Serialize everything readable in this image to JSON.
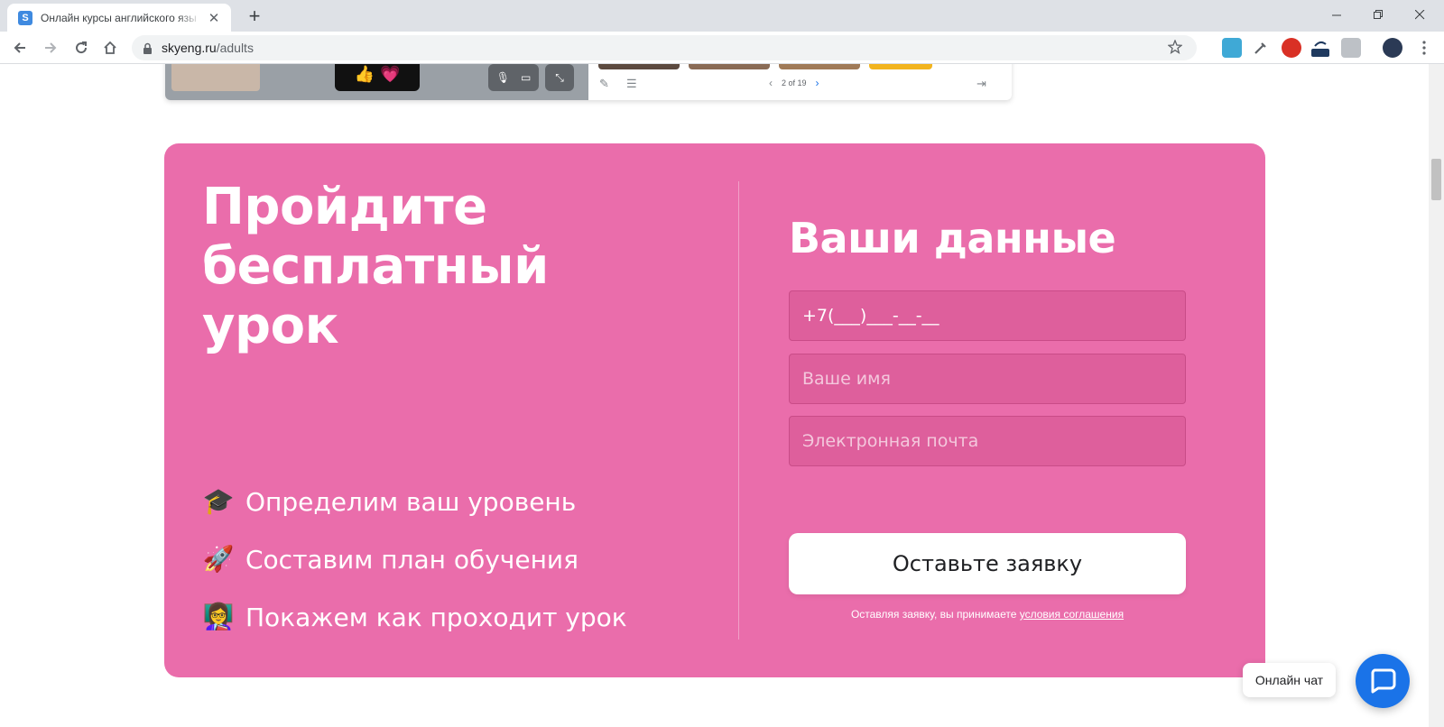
{
  "browser": {
    "tab_title": "Онлайн курсы английского язы",
    "favicon_letter": "S",
    "url_host": "skyeng.ru",
    "url_path": "/adults"
  },
  "preview": {
    "pager": "2 of 19"
  },
  "promo": {
    "headline": "Пройдите бесплатный урок",
    "features": [
      {
        "icon": "graduation-cap-icon",
        "glyph": "🎓",
        "text": "Определим ваш уровень"
      },
      {
        "icon": "rocket-icon",
        "glyph": "🚀",
        "text": "Составим план обучения"
      },
      {
        "icon": "teacher-icon",
        "glyph": "👩‍🏫",
        "text": "Покажем как проходит урок"
      }
    ]
  },
  "form": {
    "title": "Ваши данные",
    "phone_value": "+7(___)___-__-__",
    "name_placeholder": "Ваше имя",
    "email_placeholder": "Электронная почта",
    "submit_label": "Оставьте заявку",
    "legal_text": "Оставляя заявку, вы принимаете ",
    "legal_link": "условия соглашения"
  },
  "chat": {
    "label": "Онлайн чат"
  },
  "colors": {
    "card_background": "#ea6dab",
    "chat_button": "#1a73e8"
  }
}
